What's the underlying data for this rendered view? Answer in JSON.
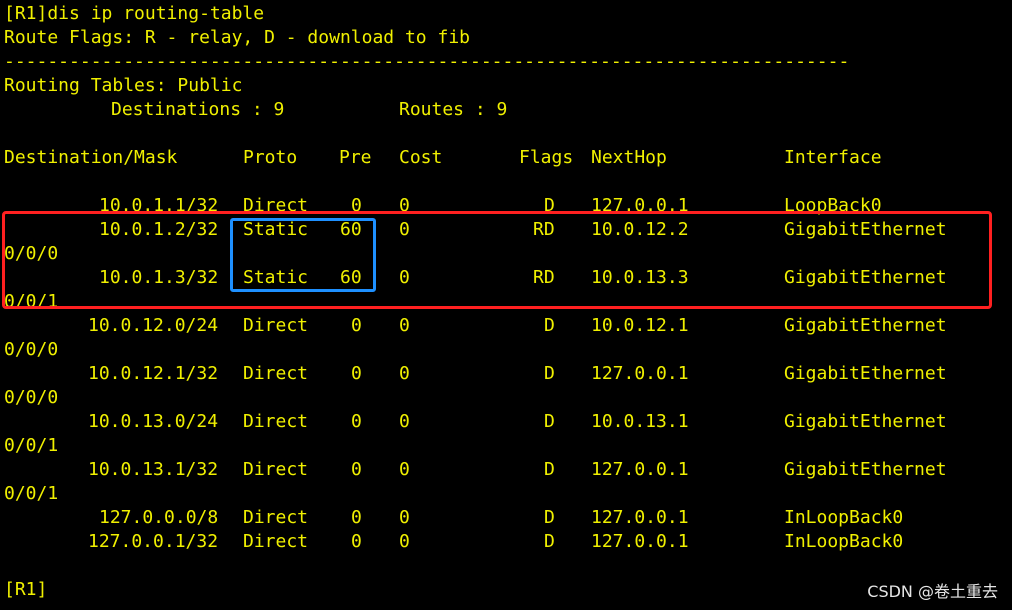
{
  "terminal": {
    "command_line": "[R1]dis ip routing-table",
    "route_flags": "Route Flags: R - relay, D - download to fib",
    "separator": "------------------------------------------------------------------------------",
    "routing_tables": "Routing Tables: Public",
    "destinations_label": "Destinations : 9",
    "routes_label": "Routes : 9",
    "headers": {
      "destination": "Destination/Mask",
      "proto": "Proto",
      "pre": "Pre",
      "cost": "Cost",
      "flags": "Flags",
      "nexthop": "NextHop",
      "interface": "Interface"
    },
    "rows": [
      {
        "destination": "10.0.1.1/32",
        "proto": "Direct",
        "pre": "0",
        "cost": "0",
        "flags": "D",
        "nexthop": "127.0.0.1",
        "interface": "LoopBack0",
        "interface_cont": ""
      },
      {
        "destination": "10.0.1.2/32",
        "proto": "Static",
        "pre": "60",
        "cost": "0",
        "flags": "RD",
        "nexthop": "10.0.12.2",
        "interface": "GigabitEthernet",
        "interface_cont": "0/0/0"
      },
      {
        "destination": "10.0.1.3/32",
        "proto": "Static",
        "pre": "60",
        "cost": "0",
        "flags": "RD",
        "nexthop": "10.0.13.3",
        "interface": "GigabitEthernet",
        "interface_cont": "0/0/1"
      },
      {
        "destination": "10.0.12.0/24",
        "proto": "Direct",
        "pre": "0",
        "cost": "0",
        "flags": "D",
        "nexthop": "10.0.12.1",
        "interface": "GigabitEthernet",
        "interface_cont": "0/0/0"
      },
      {
        "destination": "10.0.12.1/32",
        "proto": "Direct",
        "pre": "0",
        "cost": "0",
        "flags": "D",
        "nexthop": "127.0.0.1",
        "interface": "GigabitEthernet",
        "interface_cont": "0/0/0"
      },
      {
        "destination": "10.0.13.0/24",
        "proto": "Direct",
        "pre": "0",
        "cost": "0",
        "flags": "D",
        "nexthop": "10.0.13.1",
        "interface": "GigabitEthernet",
        "interface_cont": "0/0/1"
      },
      {
        "destination": "10.0.13.1/32",
        "proto": "Direct",
        "pre": "0",
        "cost": "0",
        "flags": "D",
        "nexthop": "127.0.0.1",
        "interface": "GigabitEthernet",
        "interface_cont": "0/0/1"
      },
      {
        "destination": "127.0.0.0/8",
        "proto": "Direct",
        "pre": "0",
        "cost": "0",
        "flags": "D",
        "nexthop": "127.0.0.1",
        "interface": "InLoopBack0",
        "interface_cont": ""
      },
      {
        "destination": "127.0.0.1/32",
        "proto": "Direct",
        "pre": "0",
        "cost": "0",
        "flags": "D",
        "nexthop": "127.0.0.1",
        "interface": "InLoopBack0",
        "interface_cont": ""
      }
    ],
    "prompt": "[R1]"
  },
  "annotations": {
    "red_box_color": "#ff2020",
    "blue_box_color": "#1e90ff"
  },
  "watermark": "CSDN @卷土重去",
  "colors": {
    "background": "#000000",
    "text": "#f0f000"
  }
}
